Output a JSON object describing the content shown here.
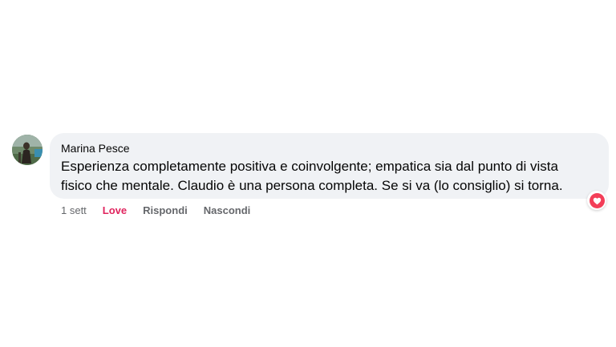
{
  "comment": {
    "author": "Marina Pesce",
    "text_line1": "Esperienza completamente positiva e coinvolgente; empatica sia dal punto di vista",
    "text_line2": "fisico che mentale. Claudio è una persona completa. Se si va (lo consiglio) si torna.",
    "timestamp": "1 sett",
    "love_label": "Love",
    "reply_label": "Rispondi",
    "hide_label": "Nascondi",
    "reaction_icon": "heart-icon"
  },
  "colors": {
    "bubble_bg": "#f0f2f5",
    "love": "#e0245e",
    "reaction_heart_bg": "#f33e58",
    "muted_text": "#65676b"
  }
}
